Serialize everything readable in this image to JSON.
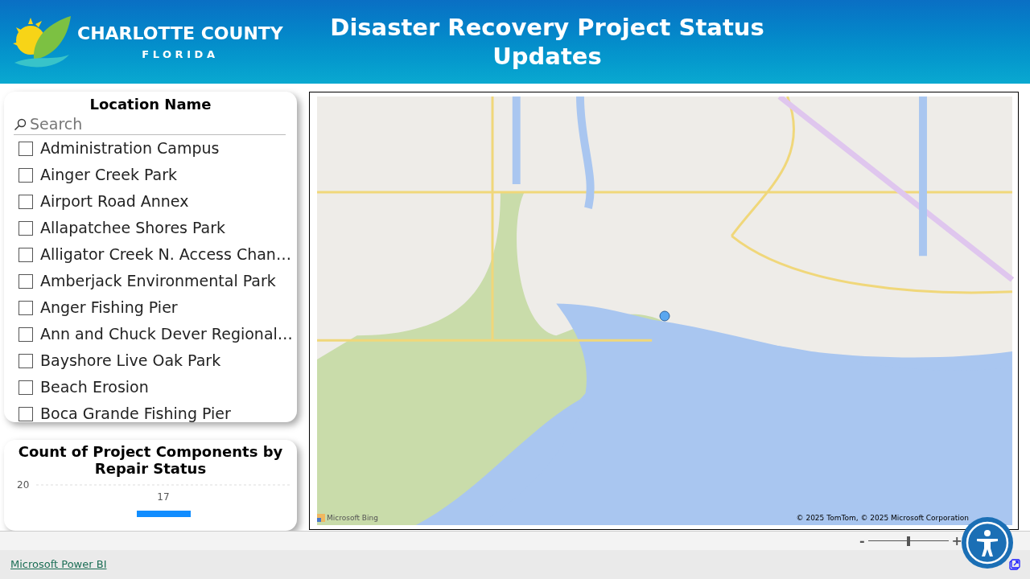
{
  "header": {
    "logo_name": "CHARLOTTE COUNTY",
    "logo_state": "FLORIDA",
    "title": "Disaster Recovery Project Status Updates"
  },
  "location_slicer": {
    "title": "Location Name",
    "search": {
      "placeholder": "Search"
    },
    "items": [
      {
        "label": "Administration Campus",
        "checked": false
      },
      {
        "label": "Ainger Creek Park",
        "checked": false
      },
      {
        "label": "Airport Road Annex",
        "checked": false
      },
      {
        "label": "Allapatchee Shores Park",
        "checked": false
      },
      {
        "label": "Alligator Creek N. Access Chan…",
        "checked": false
      },
      {
        "label": "Amberjack Environmental Park",
        "checked": false
      },
      {
        "label": "Anger Fishing Pier",
        "checked": false
      },
      {
        "label": "Ann and Chuck Dever Regional…",
        "checked": false
      },
      {
        "label": "Bayshore Live Oak Park",
        "checked": false
      },
      {
        "label": "Beach Erosion",
        "checked": false
      },
      {
        "label": "Boca Grande Fishing Pier",
        "checked": false
      }
    ]
  },
  "status_chart": {
    "title": "Count of Project Components by Repair Status",
    "gridline_label": "20",
    "bar_label": "17"
  },
  "map": {
    "attribution": "© 2025 TomTom, © 2025 Microsoft Corporation",
    "provider": "Microsoft Bing"
  },
  "footer": {
    "zoom_out": "-",
    "zoom_in": "+",
    "zoom": {
      "level": 0.5
    },
    "link": "Microsoft Power BI"
  }
}
